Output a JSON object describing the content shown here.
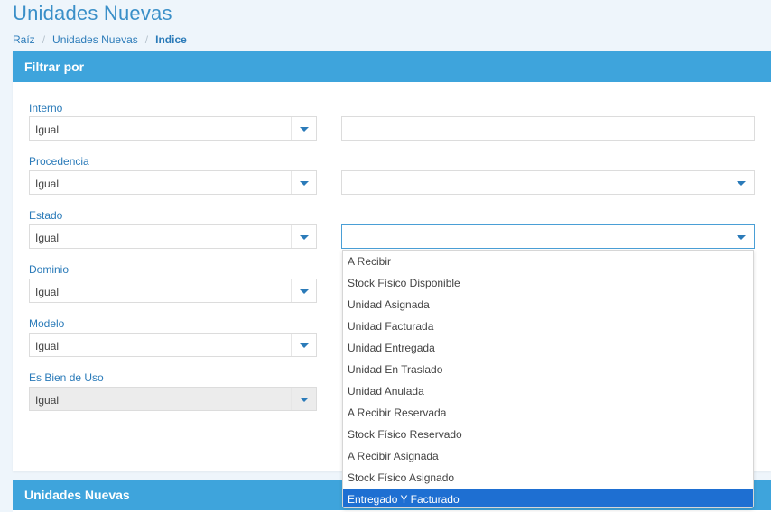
{
  "page": {
    "title": "Unidades Nuevas"
  },
  "breadcrumb": [
    "Raíz",
    "Unidades Nuevas",
    "Indice"
  ],
  "filter_panel": {
    "title": "Filtrar por",
    "fields": [
      {
        "label": "Interno",
        "operator": "Igual",
        "value": ""
      },
      {
        "label": "Procedencia",
        "operator": "Igual",
        "value": ""
      },
      {
        "label": "Estado",
        "operator": "Igual",
        "value": ""
      },
      {
        "label": "Dominio",
        "operator": "Igual"
      },
      {
        "label": "Modelo",
        "operator": "Igual"
      },
      {
        "label": "Es Bien de Uso",
        "operator": "Igual"
      }
    ]
  },
  "estado_dropdown": {
    "options": [
      "A Recibir",
      "Stock Físico Disponible",
      "Unidad Asignada",
      "Unidad Facturada",
      "Unidad Entregada",
      "Unidad En Traslado",
      "Unidad Anulada",
      "A Recibir Reservada",
      "Stock Físico Reservado",
      "A Recibir Asignada",
      "Stock Físico Asignado",
      "Entregado Y Facturado"
    ],
    "highlighted": "Entregado Y Facturado"
  },
  "units_panel": {
    "title": "Unidades Nuevas"
  },
  "colors": {
    "accent": "#3ea4dc",
    "link": "#2b7bb9",
    "highlight": "#1e6fd2",
    "background": "#eef5fb"
  }
}
